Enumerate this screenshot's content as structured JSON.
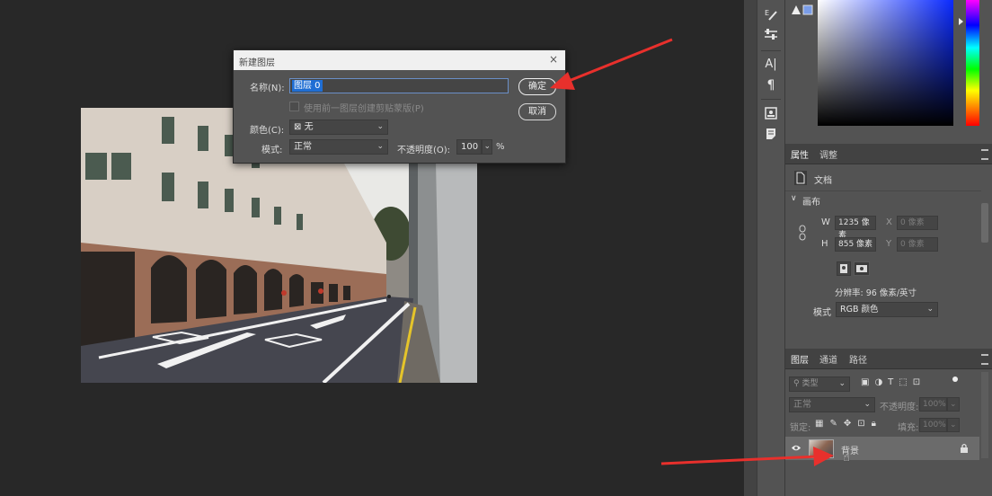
{
  "dialog": {
    "title": "新建图层",
    "close": "×",
    "name_label": "名称(N):",
    "name_value": "图层 0",
    "clip_checkbox_label": "使用前一图层创建剪贴蒙版(P)",
    "color_label": "颜色(C):",
    "color_value": "无",
    "mode_label": "模式:",
    "mode_value": "正常",
    "opacity_label": "不透明度(O):",
    "opacity_value": "100",
    "opacity_unit": "%",
    "ok_label": "确定",
    "cancel_label": "取消"
  },
  "properties": {
    "tabs": [
      "属性",
      "调整"
    ],
    "doc_label": "文档",
    "canvas_header": "画布",
    "w_label": "W",
    "w_value": "1235 像素",
    "h_label": "H",
    "h_value": "855 像素",
    "x_label": "X",
    "x_value": "0 像素",
    "y_label": "Y",
    "y_value": "0 像素",
    "resolution": "分辨率: 96 像素/英寸",
    "mode_label": "模式",
    "mode_value": "RGB 颜色"
  },
  "layers": {
    "tabs": [
      "图层",
      "通道",
      "路径"
    ],
    "filter_placeholder": "类型",
    "blend_mode": "正常",
    "opacity_label": "不透明度:",
    "opacity_value": "100%",
    "lock_label": "锁定:",
    "fill_label": "填充:",
    "fill_value": "100%",
    "items": [
      {
        "name": "背景",
        "visible": true,
        "locked": true
      }
    ]
  },
  "icons": [
    "brush-settings-icon",
    "adjust-sliders-icon",
    "character-icon",
    "paragraph-icon",
    "glyphs-icon",
    "notes-icon",
    "eye-icon",
    "lock-icon",
    "search-icon"
  ],
  "colors": {
    "annotation_arrow": "#e8302c",
    "highlight": "#1f6ed4"
  }
}
